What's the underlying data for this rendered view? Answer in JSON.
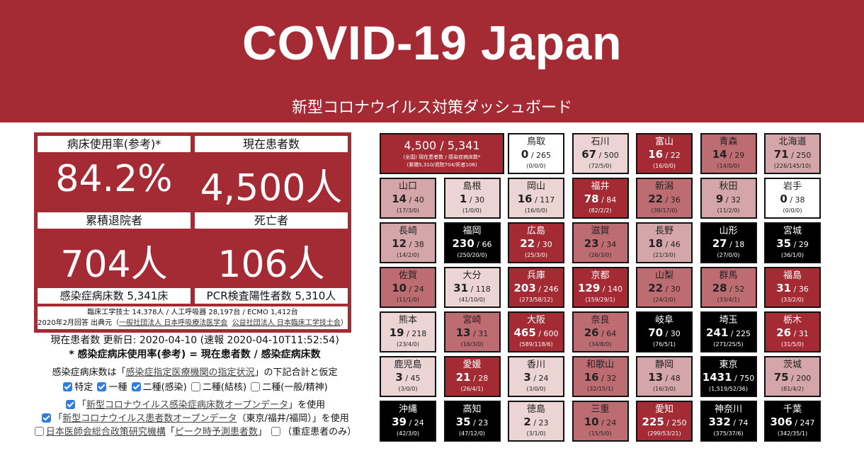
{
  "header": {
    "title": "COVID-19 Japan",
    "subtitle": "新型コロナウイルス対策ダッシュボード"
  },
  "panel": {
    "bed_rate_label": "病床使用率(参考)*",
    "bed_rate_value": "84.2%",
    "current_label": "現在患者数",
    "current_value": "4,500人",
    "discharged_label": "累積退院者",
    "discharged_value": "704人",
    "deaths_label": "死亡者",
    "deaths_value": "106人",
    "beds_footer": "感染症病床数 5,341床",
    "pcr_footer": "PCR検査陽性者数 5,310人",
    "note_line1": "臨床工学技士 14,378人 / 人工呼吸器 28,197台 / ECMO 1,412台",
    "note_line2_prefix": "2020年2月回答 出典元（",
    "note_link1": "一般社団法人 日本呼吸療法医学会",
    "note_link2": "公益社団法人 日本臨床工学技士会",
    "note_line2_suffix": "）"
  },
  "info": {
    "updated": "現在患者数 更新日: 2020-04-10 (速報 2020-04-10T11:52:54)",
    "formula": "* 感染症病床使用率(参考) = 現在患者数 / 感染症病床数",
    "assumption_prefix": "感染症病床数は「",
    "assumption_link": "感染症指定医療機関の指定状況",
    "assumption_suffix": "」の下記合計と仮定",
    "opt_specific": "特定",
    "opt_class1": "一種",
    "opt_class2": "二種(感染)",
    "opt_tb": "二種(結核)",
    "opt_general": "二種(一般/精神)",
    "open_data_prefix": "「",
    "open_data_link": "新型コロナウイルス感染症病床数オープンデータ",
    "open_data_suffix": "」を使用",
    "patients_prefix": "「",
    "patients_link": "新型コロナウイルス患者数オープンデータ",
    "patients_suffix": "（東京/福井/福岡）」を使用",
    "jmari_link": "日本医師会総合政策研究機構",
    "peak_prefix": "「",
    "peak_link": "ピーク時予測患者数",
    "peak_suffix": "」",
    "severe_label": "（重症患者のみ）"
  },
  "summary_cell": {
    "value": "4,500 / 5,341",
    "note1": "(全国) 現在患者数 / 感染症病床数*",
    "note2": "(累積5,310/退院704/死者106)"
  },
  "colors": {
    "brand": "#a42a34",
    "level0": "#ffffff",
    "level1": "#ecd3d4",
    "level2": "#d5a6a9",
    "level3": "#bd6d72",
    "level4": "#a42a34",
    "level5": "#000000"
  },
  "prefectures": [
    {
      "name": "鳥取",
      "cur": "0",
      "beds": "265",
      "sub": "(0/0/0)",
      "level": 0
    },
    {
      "name": "石川",
      "cur": "67",
      "beds": "500",
      "sub": "(72/5/0)",
      "level": 1
    },
    {
      "name": "富山",
      "cur": "16",
      "beds": "22",
      "sub": "(16/0/0)",
      "level": 4
    },
    {
      "name": "青森",
      "cur": "14",
      "beds": "29",
      "sub": "(14/0/0)",
      "level": 3
    },
    {
      "name": "北海道",
      "cur": "71",
      "beds": "250",
      "sub": "(226/145/10)",
      "level": 2
    },
    {
      "name": "山口",
      "cur": "14",
      "beds": "40",
      "sub": "(17/3/0)",
      "level": 2
    },
    {
      "name": "島根",
      "cur": "1",
      "beds": "30",
      "sub": "(1/0/0)",
      "level": 1
    },
    {
      "name": "岡山",
      "cur": "16",
      "beds": "117",
      "sub": "(16/0/0)",
      "level": 1
    },
    {
      "name": "福井",
      "cur": "78",
      "beds": "84",
      "sub": "(82/2/2)",
      "level": 4
    },
    {
      "name": "新潟",
      "cur": "22",
      "beds": "36",
      "sub": "(39/17/0)",
      "level": 3
    },
    {
      "name": "秋田",
      "cur": "9",
      "beds": "32",
      "sub": "(11/2/0)",
      "level": 2
    },
    {
      "name": "岩手",
      "cur": "0",
      "beds": "38",
      "sub": "(0/0/0)",
      "level": 0
    },
    {
      "name": "長崎",
      "cur": "12",
      "beds": "38",
      "sub": "(14/2/0)",
      "level": 2
    },
    {
      "name": "福岡",
      "cur": "230",
      "beds": "66",
      "sub": "(250/20/0)",
      "level": 5
    },
    {
      "name": "広島",
      "cur": "22",
      "beds": "30",
      "sub": "(25/3/0)",
      "level": 4
    },
    {
      "name": "滋賀",
      "cur": "23",
      "beds": "34",
      "sub": "(26/3/0)",
      "level": 3
    },
    {
      "name": "長野",
      "cur": "18",
      "beds": "46",
      "sub": "(21/3/0)",
      "level": 2
    },
    {
      "name": "山形",
      "cur": "27",
      "beds": "18",
      "sub": "(27/0/0)",
      "level": 5
    },
    {
      "name": "宮城",
      "cur": "35",
      "beds": "29",
      "sub": "(36/1/0)",
      "level": 5
    },
    {
      "name": "佐賀",
      "cur": "10",
      "beds": "24",
      "sub": "(11/1/0)",
      "level": 3
    },
    {
      "name": "大分",
      "cur": "31",
      "beds": "118",
      "sub": "(41/10/0)",
      "level": 1
    },
    {
      "name": "兵庫",
      "cur": "203",
      "beds": "246",
      "sub": "(273/58/12)",
      "level": 4
    },
    {
      "name": "京都",
      "cur": "129",
      "beds": "140",
      "sub": "(159/29/1)",
      "level": 4
    },
    {
      "name": "山梨",
      "cur": "22",
      "beds": "30",
      "sub": "(24/2/0)",
      "level": 3
    },
    {
      "name": "群馬",
      "cur": "28",
      "beds": "52",
      "sub": "(33/4/1)",
      "level": 3
    },
    {
      "name": "福島",
      "cur": "31",
      "beds": "36",
      "sub": "(33/2/0)",
      "level": 4
    },
    {
      "name": "熊本",
      "cur": "19",
      "beds": "218",
      "sub": "(23/4/0)",
      "level": 1
    },
    {
      "name": "宮崎",
      "cur": "13",
      "beds": "31",
      "sub": "(16/3/0)",
      "level": 3
    },
    {
      "name": "大阪",
      "cur": "465",
      "beds": "600",
      "sub": "(589/118/6)",
      "level": 4
    },
    {
      "name": "奈良",
      "cur": "26",
      "beds": "64",
      "sub": "(34/8/0)",
      "level": 3
    },
    {
      "name": "岐阜",
      "cur": "70",
      "beds": "30",
      "sub": "(76/5/1)",
      "level": 5
    },
    {
      "name": "埼玉",
      "cur": "241",
      "beds": "225",
      "sub": "(271/25/5)",
      "level": 5
    },
    {
      "name": "栃木",
      "cur": "26",
      "beds": "31",
      "sub": "(31/5/0)",
      "level": 4
    },
    {
      "name": "鹿児島",
      "cur": "3",
      "beds": "45",
      "sub": "(3/0/0)",
      "level": 1
    },
    {
      "name": "愛媛",
      "cur": "21",
      "beds": "28",
      "sub": "(26/4/1)",
      "level": 4
    },
    {
      "name": "香川",
      "cur": "3",
      "beds": "24",
      "sub": "(3/0/0)",
      "level": 1
    },
    {
      "name": "和歌山",
      "cur": "16",
      "beds": "32",
      "sub": "(32/15/1)",
      "level": 3
    },
    {
      "name": "静岡",
      "cur": "13",
      "beds": "48",
      "sub": "(16/3/0)",
      "level": 2
    },
    {
      "name": "東京",
      "cur": "1431",
      "beds": "750",
      "sub": "(1,519/52/36)",
      "level": 5
    },
    {
      "name": "茨城",
      "cur": "75",
      "beds": "200",
      "sub": "(81/4/2)",
      "level": 2
    },
    {
      "name": "沖縄",
      "cur": "39",
      "beds": "24",
      "sub": "(42/3/0)",
      "level": 5
    },
    {
      "name": "高知",
      "cur": "35",
      "beds": "23",
      "sub": "(47/12/0)",
      "level": 5
    },
    {
      "name": "徳島",
      "cur": "2",
      "beds": "23",
      "sub": "(3/1/0)",
      "level": 1
    },
    {
      "name": "三重",
      "cur": "10",
      "beds": "24",
      "sub": "(15/5/0)",
      "level": 3
    },
    {
      "name": "愛知",
      "cur": "225",
      "beds": "250",
      "sub": "(299/53/21)",
      "level": 4
    },
    {
      "name": "神奈川",
      "cur": "332",
      "beds": "74",
      "sub": "(375/37/6)",
      "level": 5
    },
    {
      "name": "千葉",
      "cur": "306",
      "beds": "247",
      "sub": "(342/35/1)",
      "level": 5
    }
  ]
}
